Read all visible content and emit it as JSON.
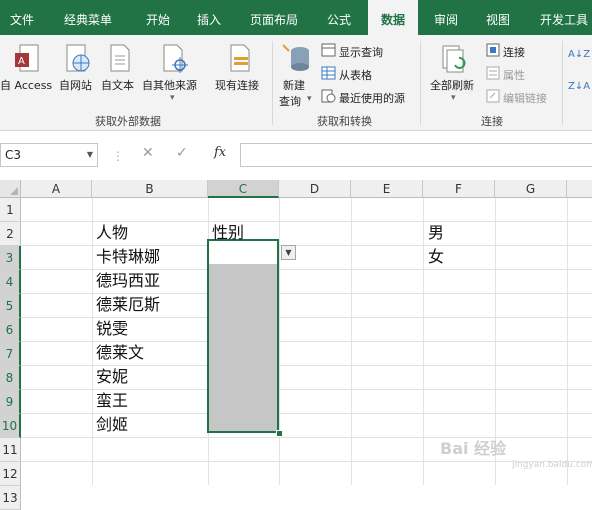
{
  "ribbon_tabs": [
    "文件",
    "经典菜单",
    "开始",
    "插入",
    "页面布局",
    "公式",
    "数据",
    "审阅",
    "视图",
    "开发工具"
  ],
  "active_tab": "数据",
  "colors": {
    "accent": "#217346",
    "selection_shade": "#c6c6c6"
  },
  "groups": {
    "external": {
      "label": "获取外部数据",
      "buttons": [
        "自 Access",
        "自网站",
        "自文本",
        "自其他来源",
        "现有连接"
      ]
    },
    "transform": {
      "label": "获取和转换",
      "new_query": [
        "新建",
        "查询"
      ],
      "small": [
        "显示查询",
        "从表格",
        "最近使用的源"
      ]
    },
    "connections": {
      "label": "连接",
      "refresh_all": "全部刷新",
      "small": [
        "连接",
        "属性",
        "编辑链接"
      ]
    },
    "sort_labels": [
      "A↓Z",
      "Z↓A"
    ]
  },
  "formula_bar": {
    "name_box": "C3",
    "fx": "fx",
    "value": ""
  },
  "columns": [
    "A",
    "B",
    "C",
    "D",
    "E",
    "F",
    "G"
  ],
  "rows": [
    "1",
    "2",
    "3",
    "4",
    "5",
    "6",
    "7",
    "8",
    "9",
    "10",
    "11",
    "12",
    "13"
  ],
  "cells": {
    "B2": "人物",
    "C2": "性别",
    "B3": "卡特琳娜",
    "B4": "德玛西亚",
    "B5": "德莱厄斯",
    "B6": "锐雯",
    "B7": "德莱文",
    "B8": "安妮",
    "B9": "蛮王",
    "B10": "剑姬",
    "F2": "男",
    "F3": "女"
  },
  "watermark": {
    "brand": "Bai 经验",
    "url": "jingyan.baidu.com"
  }
}
